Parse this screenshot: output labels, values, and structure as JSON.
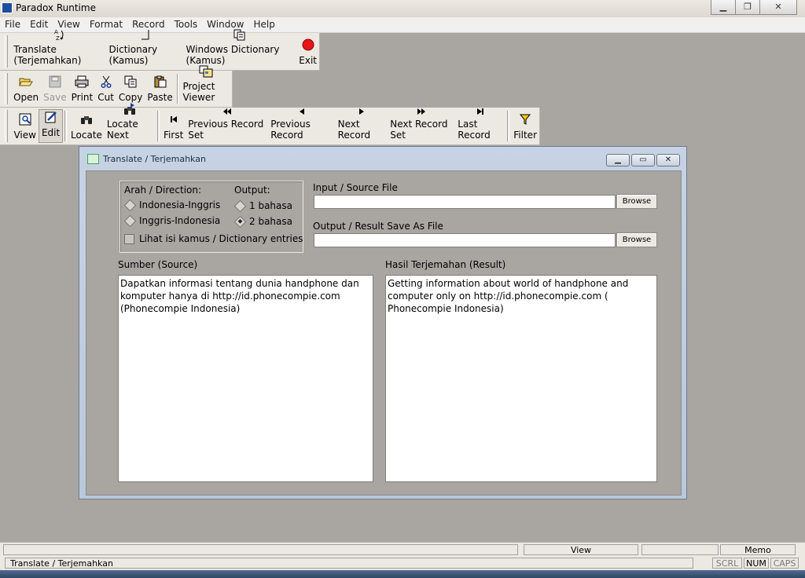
{
  "window": {
    "title": "Paradox Runtime"
  },
  "menu": [
    "File",
    "Edit",
    "View",
    "Format",
    "Record",
    "Tools",
    "Window",
    "Help"
  ],
  "toolbar1": [
    {
      "label": "Translate (Terjemahkan)"
    },
    {
      "label": "Dictionary (Kamus)"
    },
    {
      "label": "Windows Dictionary (Kamus)"
    },
    {
      "label": "Exit"
    }
  ],
  "toolbar2": [
    {
      "label": "Open"
    },
    {
      "label": "Save"
    },
    {
      "label": "Print"
    },
    {
      "label": "Cut"
    },
    {
      "label": "Copy"
    },
    {
      "label": "Paste"
    },
    {
      "label": "Project Viewer"
    }
  ],
  "toolbar3": [
    {
      "label": "View"
    },
    {
      "label": "Edit"
    },
    {
      "label": "Locate"
    },
    {
      "label": "Locate Next"
    },
    {
      "label": "First"
    },
    {
      "label": "Previous Record Set"
    },
    {
      "label": "Previous Record"
    },
    {
      "label": "Next Record"
    },
    {
      "label": "Next Record Set"
    },
    {
      "label": "Last Record"
    },
    {
      "label": "Filter"
    }
  ],
  "dialog": {
    "title": "Translate / Terjemahkan",
    "direction_label": "Arah / Direction:",
    "direction_options": [
      "Indonesia-Inggris",
      "Inggris-Indonesia"
    ],
    "direction_selected": "Indonesia-Inggris",
    "output_label": "Output:",
    "output_options": [
      "1 bahasa",
      "2 bahasa"
    ],
    "output_selected": "2 bahasa",
    "dictionary_checkbox": "Lihat isi kamus / Dictionary entries",
    "input_file_label": "Input / Source File",
    "output_file_label": "Output / Result Save As File",
    "browse_label": "Browse",
    "source_label": "Sumber (Source)",
    "source_text": "Dapatkan informasi tentang dunia handphone dan\nkomputer hanya di http://id.phonecompie.com\n(Phonecompie Indonesia)",
    "result_label": "Hasil Terjemahan (Result)",
    "result_text": "Getting information about world of handphone and\ncomputer only on http://id.phonecompie.com (\nPhonecompie Indonesia)"
  },
  "status": {
    "view": "View",
    "memo": "Memo",
    "form_name": "Translate / Terjemahkan",
    "scrl": "SCRL",
    "num": "NUM",
    "caps": "CAPS"
  }
}
